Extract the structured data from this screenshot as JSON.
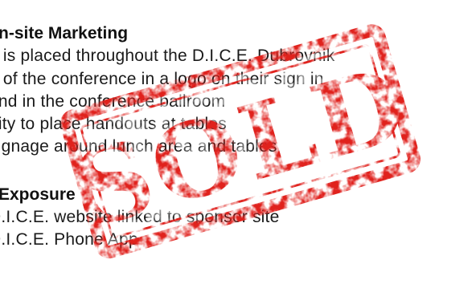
{
  "sections": {
    "onsite": {
      "heading": "n-site Marketing",
      "lines": [
        "o is placed throughout the D.I.C.E. Dubrovnik",
        "h of the conference in a logo on their sign in",
        " and in the conference ballroom",
        "nity to place handouts at tables",
        " signage around lunch area and tables"
      ]
    },
    "exposure": {
      "heading": "Exposure",
      "lines": [
        " D.I.C.E. website linked to sponsor site",
        " D.I.C.E. Phone App"
      ]
    }
  },
  "stamp": {
    "text": "SOLD",
    "color": "#e0201c"
  }
}
